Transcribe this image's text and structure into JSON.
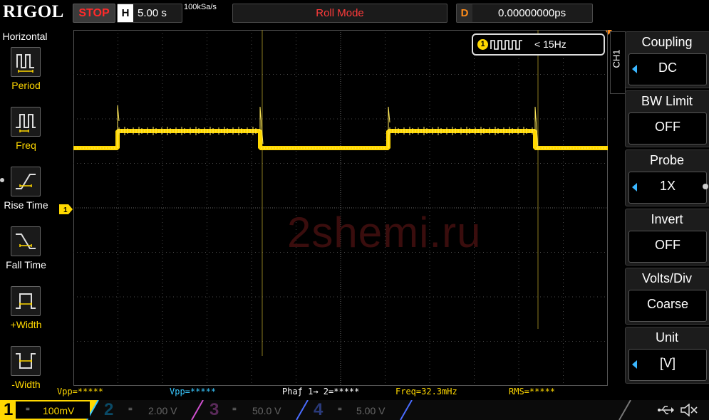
{
  "topbar": {
    "logo": "RIGOL",
    "run_status": "STOP",
    "horizontal_letter": "H",
    "timebase": "5.00 s",
    "sample_rate": "100kSa/s",
    "mode": "Roll Mode",
    "delay_letter": "D",
    "delay": "0.00000000ps"
  },
  "left_menu": {
    "title": "Horizontal",
    "items": [
      {
        "label": "Period",
        "icon": "period-icon"
      },
      {
        "label": "Freq",
        "icon": "freq-icon"
      },
      {
        "label": "Rise Time",
        "icon": "rise-time-icon"
      },
      {
        "label": "Fall Time",
        "icon": "fall-time-icon"
      },
      {
        "label": "+Width",
        "icon": "plus-width-icon"
      },
      {
        "label": "-Width",
        "icon": "minus-width-icon"
      }
    ]
  },
  "watermark": "2shemi.ru",
  "ch1_marker": "1",
  "freq_readout": {
    "channel": "1",
    "value": "< 15Hz"
  },
  "measurements": [
    {
      "text": "Vpp=*****",
      "color": "yellow"
    },
    {
      "text": "Vpp=*****",
      "color": "cyan"
    },
    {
      "text": "Phaƒ 1→ 2=*****",
      "color": "white"
    },
    {
      "text": "Freq=32.3mHz",
      "color": "yellow"
    },
    {
      "text": "RMS=*****",
      "color": "yellow"
    }
  ],
  "right_menu": {
    "channel_tab": "CH1",
    "items": [
      {
        "title": "Coupling",
        "value": "DC",
        "has_arrow": true
      },
      {
        "title": "BW Limit",
        "value": "OFF",
        "has_arrow": false
      },
      {
        "title": "Probe",
        "value": "1X",
        "has_arrow": true
      },
      {
        "title": "Invert",
        "value": "OFF",
        "has_arrow": false
      },
      {
        "title": "Volts/Div",
        "value": "Coarse",
        "has_arrow": false
      },
      {
        "title": "Unit",
        "value": "[V]",
        "has_arrow": true
      }
    ]
  },
  "channels": [
    {
      "num": "1",
      "coupling": "=",
      "scale": "100mV",
      "color": "#ffd800",
      "active": true
    },
    {
      "num": "2",
      "coupling": "=",
      "scale": "2.00 V",
      "color": "#38c8ff",
      "active": false
    },
    {
      "num": "3",
      "coupling": "=",
      "scale": "50.0 V",
      "color": "#d050d0",
      "active": false
    },
    {
      "num": "4",
      "coupling": "=",
      "scale": "5.00 V",
      "color": "#4a6cff",
      "active": false
    }
  ],
  "colors": {
    "ch1": "#ffd800",
    "ch2": "#38c8ff",
    "ch3": "#d050d0",
    "ch4": "#4a6cff",
    "stop": "#ff2a2a",
    "accent": "#ff8c1a"
  }
}
